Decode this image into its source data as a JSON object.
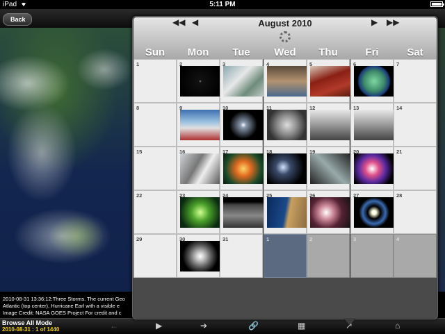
{
  "status_bar": {
    "carrier": "iPad",
    "time": "5:11 PM"
  },
  "nav": {
    "back_label": "Back"
  },
  "caption": {
    "lines": [
      "2010-08-31 13:36:12:Three Storms. The current Geo",
      "Atlantic (top center), Hurricane Earl with a visible e",
      "Image Credit: NASA GOES Project   For credit and c"
    ]
  },
  "toolbar": {
    "mode_title": "Browse All Mode",
    "mode_info": "2010-08-31 : 1 of 1440",
    "icons": [
      "arrow-left-icon",
      "play-icon",
      "arrow-right-icon",
      "link-icon",
      "calendar-icon",
      "share-icon",
      "home-icon"
    ]
  },
  "calendar": {
    "month_label": "August 2010",
    "weekdays": [
      "Sun",
      "Mon",
      "Tue",
      "Wed",
      "Thu",
      "Fri",
      "Sat"
    ],
    "weeks": [
      [
        {
          "n": "1",
          "t": ""
        },
        {
          "n": "2",
          "t": "rings"
        },
        {
          "n": "3",
          "t": "clouds"
        },
        {
          "n": "4",
          "t": "room"
        },
        {
          "n": "5",
          "t": "red"
        },
        {
          "n": "6",
          "t": "sun"
        },
        {
          "n": "7",
          "t": ""
        }
      ],
      [
        {
          "n": "8",
          "t": ""
        },
        {
          "n": "9",
          "t": "people"
        },
        {
          "n": "10",
          "t": "space"
        },
        {
          "n": "11",
          "t": "engine"
        },
        {
          "n": "12",
          "t": "lab"
        },
        {
          "n": "13",
          "t": "lab"
        },
        {
          "n": "14",
          "t": ""
        }
      ],
      [
        {
          "n": "15",
          "t": ""
        },
        {
          "n": "16",
          "t": "station"
        },
        {
          "n": "17",
          "t": "nebula"
        },
        {
          "n": "18",
          "t": "stars"
        },
        {
          "n": "19",
          "t": "dark"
        },
        {
          "n": "20",
          "t": "pink"
        },
        {
          "n": "21",
          "t": ""
        }
      ],
      [
        {
          "n": "22",
          "t": ""
        },
        {
          "n": "23",
          "t": "green"
        },
        {
          "n": "24",
          "t": "moon"
        },
        {
          "n": "25",
          "t": "coast"
        },
        {
          "n": "26",
          "t": "bubbles"
        },
        {
          "n": "27",
          "t": "ring"
        },
        {
          "n": "28",
          "t": ""
        }
      ],
      [
        {
          "n": "29",
          "t": ""
        },
        {
          "n": "30",
          "t": "galaxy"
        },
        {
          "n": "31",
          "t": ""
        },
        {
          "n": "1",
          "t": "",
          "state": "today"
        },
        {
          "n": "2",
          "t": "",
          "state": "future"
        },
        {
          "n": "3",
          "t": "",
          "state": "future"
        },
        {
          "n": "4",
          "t": "",
          "state": "future"
        }
      ]
    ]
  },
  "thumb_styles": {
    "rings": "radial-gradient(circle at 50% 50%, #888 0, #111 2px, #000 30px), #000",
    "clouds": "linear-gradient(135deg, #8aa8b0, #e8e8e8 40%, #6d8b7a 70%, #bfc9c7)",
    "room": "linear-gradient(#5a4a3a, #b39270 50%, #4a6a8a)",
    "red": "linear-gradient(160deg, #d8c9b8, #8a1f14 40%, #b13a2a 70%, #5a1a10)",
    "sun": "radial-gradient(circle, #7fd7a0 0, #3d8a6a 40%, #1a3a7a 60%, #000 66%)",
    "people": "linear-gradient(#3d6fb0, #9ac1e0 40%, #e0e0e0 60%, #b03030)",
    "space": "radial-gradient(circle, #fff 0, #8a9ab0 4px, #000 20px)",
    "engine": "radial-gradient(circle, #ddd 0, #888 40%, #333 75%)",
    "lab": "linear-gradient(#e8e8e8, #999 50%, #444)",
    "station": "linear-gradient(120deg, #cfd3d8, #777 40%, #eee 60%, #555)",
    "nebula": "radial-gradient(circle, #ffd36a 0, #e06a20 30%, #1a4a2a 70%, #0a1a10)",
    "stars": "radial-gradient(circle at 40% 45%, #cfe0ff 0, #3a4a6a 25%, #000 70%)",
    "dark": "linear-gradient(45deg, #222, #9aa 50%, #222)",
    "pink": "radial-gradient(circle at 45% 50%, #fff 0, #e0508a 25%, #5a2aa0 50%, #000 80%)",
    "green": "radial-gradient(circle, #d0ff90 0, #4aa02a 35%, #0a2a10 80%)",
    "moon": "linear-gradient(#000 15%, #444 25%, #888 60%, #333)",
    "coast": "linear-gradient(100deg, #0a2a5a, #1a4a8a 45%, #c8a060 55%, #8a6a40)",
    "bubbles": "radial-gradient(circle at 40% 50%, #fff 0, #c89 25%, #523 55%, #111)",
    "ring": "radial-gradient(circle, #fff 0, #ffd 8%, #000 25%, #3a6ab0 45%, #000 60%)",
    "galaxy": "radial-gradient(circle, #fff 0, #ccc 15%, #555 45%, #000 70%)"
  }
}
